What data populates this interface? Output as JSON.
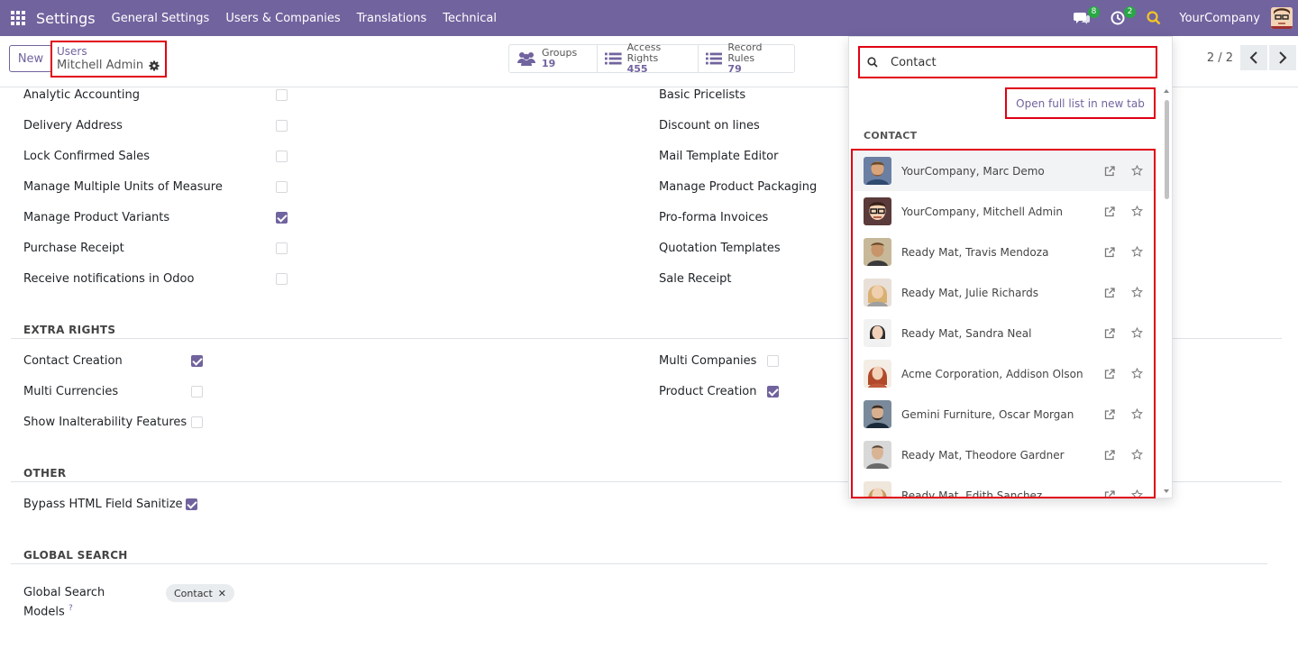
{
  "navbar": {
    "app_title": "Settings",
    "menu": [
      "General Settings",
      "Users & Companies",
      "Translations",
      "Technical"
    ],
    "messages_badge": "8",
    "activities_badge": "2",
    "company": "YourCompany",
    "color": "#71639e"
  },
  "control": {
    "new_label": "New",
    "breadcrumb_parent": "Users",
    "breadcrumb_current": "Mitchell Admin",
    "stats": [
      {
        "label": "Groups",
        "count": "19",
        "icon": "users-icon"
      },
      {
        "label": "Access Rights",
        "count": "455",
        "icon": "list-icon"
      },
      {
        "label": "Record Rules",
        "count": "79",
        "icon": "list-icon"
      }
    ],
    "pager": "2 / 2"
  },
  "form": {
    "left_rows": [
      {
        "label": "Analytic Accounting",
        "checked": false
      },
      {
        "label": "Delivery Address",
        "checked": false
      },
      {
        "label": "Lock Confirmed Sales",
        "checked": false
      },
      {
        "label": "Manage Multiple Units of Measure",
        "checked": false
      },
      {
        "label": "Manage Product Variants",
        "checked": true
      },
      {
        "label": "Purchase Receipt",
        "checked": false
      },
      {
        "label": "Receive notifications in Odoo",
        "checked": false
      }
    ],
    "right_rows": [
      {
        "label": "Basic Pricelists"
      },
      {
        "label": "Discount on lines"
      },
      {
        "label": "Mail Template Editor"
      },
      {
        "label": "Manage Product Packaging"
      },
      {
        "label": "Pro-forma Invoices"
      },
      {
        "label": "Quotation Templates"
      },
      {
        "label": "Sale Receipt"
      }
    ],
    "extra_rights_title": "EXTRA RIGHTS",
    "extra_left": [
      {
        "label": "Contact Creation",
        "checked": true
      },
      {
        "label": "Multi Currencies",
        "checked": false
      },
      {
        "label": "Show Inalterability Features",
        "checked": false
      }
    ],
    "extra_right": [
      {
        "label": "Multi Companies",
        "checked": false
      },
      {
        "label": "Product Creation",
        "checked": true
      }
    ],
    "other_title": "OTHER",
    "bypass_label": "Bypass HTML Field Sanitize",
    "bypass_checked": true,
    "global_search_title": "GLOBAL SEARCH",
    "global_search_label_1": "Global Search",
    "global_search_label_2": "Models",
    "help_mark": "?",
    "tag_label": "Contact",
    "tag_remove": "✕"
  },
  "dropdown": {
    "search_value": "Contact",
    "open_full_label": "Open full list in new tab",
    "group_title": "CONTACT",
    "results": [
      {
        "name": "YourCompany, Marc Demo",
        "avatar_color": "#a0785a"
      },
      {
        "name": "YourCompany, Mitchell Admin",
        "avatar_color": "#7a4b3a"
      },
      {
        "name": "Ready Mat, Travis Mendoza",
        "avatar_color": "#9a7a55"
      },
      {
        "name": "Ready Mat, Julie Richards",
        "avatar_color": "#d8b080"
      },
      {
        "name": "Ready Mat, Sandra Neal",
        "avatar_color": "#4a4a4a"
      },
      {
        "name": "Acme Corporation, Addison Olson",
        "avatar_color": "#b25a3a"
      },
      {
        "name": "Gemini Furniture, Oscar Morgan",
        "avatar_color": "#6a7a8a"
      },
      {
        "name": "Ready Mat, Theodore Gardner",
        "avatar_color": "#8a8a8a"
      },
      {
        "name": "Ready Mat, Edith Sanchez",
        "avatar_color": "#c89a70"
      }
    ]
  }
}
